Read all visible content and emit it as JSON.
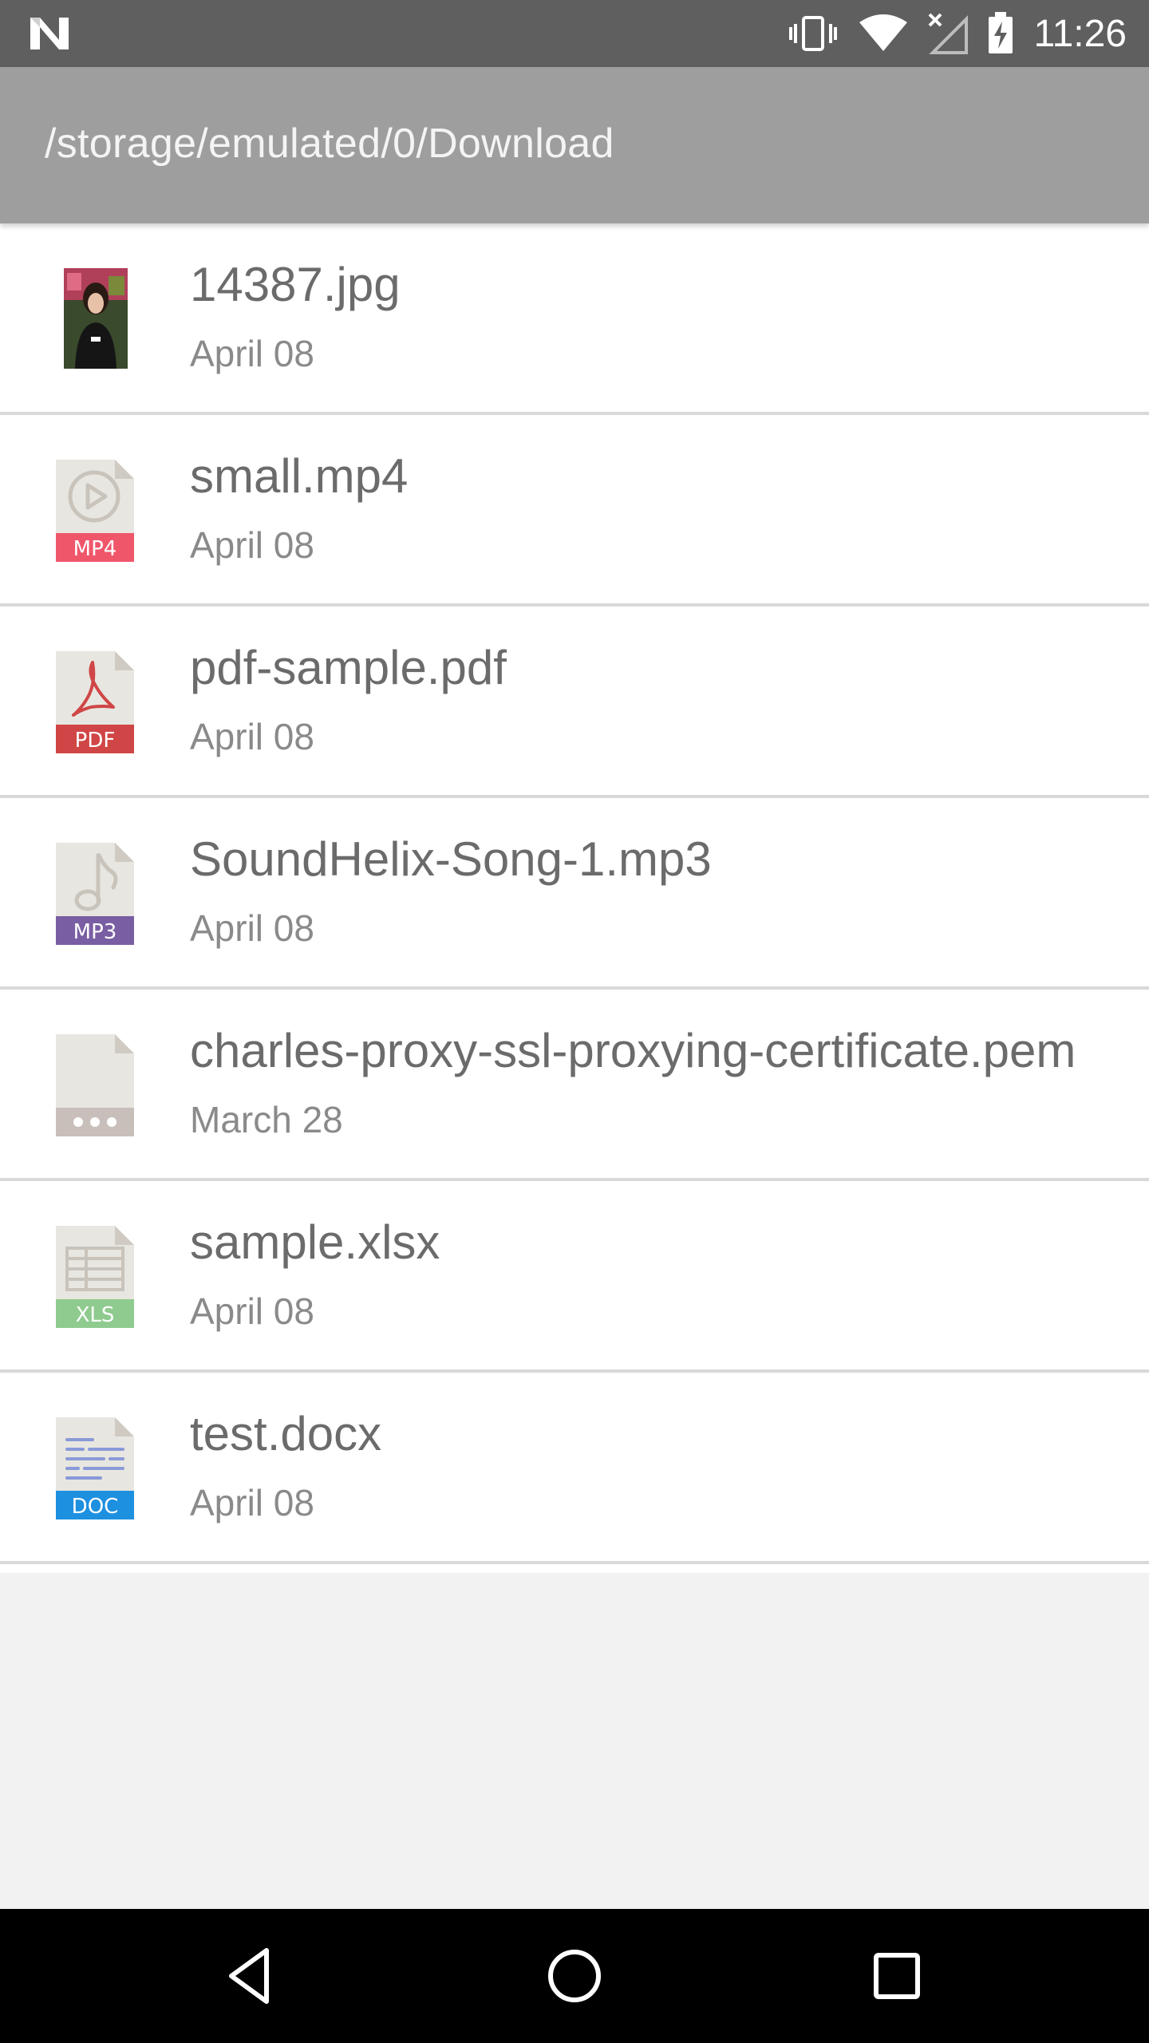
{
  "status_bar": {
    "time": "11:26",
    "icons": [
      "n-logo-icon",
      "vibrate-icon",
      "wifi-icon",
      "no-signal-icon",
      "battery-charging-icon"
    ]
  },
  "path_bar": {
    "path": "/storage/emulated/0/Download"
  },
  "files": [
    {
      "name": "14387.jpg",
      "date": "April 08",
      "type": "jpg",
      "icon": "image-thumbnail-icon"
    },
    {
      "name": "small.mp4",
      "date": "April 08",
      "type": "mp4",
      "badge": "MP4",
      "badge_color": "#f0566a",
      "icon": "mp4-file-icon"
    },
    {
      "name": "pdf-sample.pdf",
      "date": "April 08",
      "type": "pdf",
      "badge": "PDF",
      "badge_color": "#d04646",
      "icon": "pdf-file-icon"
    },
    {
      "name": "SoundHelix-Song-1.mp3",
      "date": "April 08",
      "type": "mp3",
      "badge": "MP3",
      "badge_color": "#7a5ea3",
      "icon": "mp3-file-icon"
    },
    {
      "name": "charles-proxy-ssl-proxying-certificate.pem",
      "date": "March 28",
      "type": "pem",
      "icon": "generic-file-icon"
    },
    {
      "name": "sample.xlsx",
      "date": "April 08",
      "type": "xls",
      "badge": "XLS",
      "badge_color": "#8fcb8f",
      "icon": "xls-file-icon"
    },
    {
      "name": "test.docx",
      "date": "April 08",
      "type": "doc",
      "badge": "DOC",
      "badge_color": "#1e90e0",
      "icon": "doc-file-icon"
    }
  ],
  "nav_bar": {
    "buttons": [
      "back-icon",
      "home-icon",
      "recents-icon"
    ]
  },
  "colors": {
    "status_bar": "#5f5f5f",
    "path_bar": "#9e9e9e",
    "list_bg": "#ffffff",
    "empty_bg": "#f2f2f2",
    "nav_bar": "#000000"
  }
}
